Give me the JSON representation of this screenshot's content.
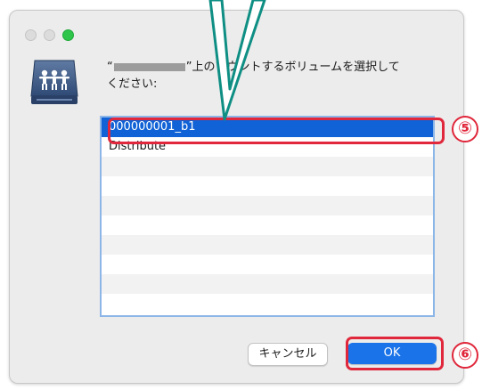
{
  "dialog": {
    "prompt_open_quote": "“",
    "prompt_after_server": "”上のマウントするボリュームを選択して",
    "prompt_line2": "ください:",
    "volumes": [
      {
        "name": "000000001_b1",
        "selected": true
      },
      {
        "name": "Distribute",
        "selected": false
      }
    ],
    "buttons": {
      "cancel": "キャンセル",
      "ok": "OK"
    }
  },
  "annotations": {
    "step_select_volume": "⑤",
    "step_click_ok": "⑥"
  },
  "colors": {
    "selection": "#1062d6",
    "ok_button": "#1a73e8",
    "callout": "#e0273b",
    "arrow": "#0f8f84"
  }
}
